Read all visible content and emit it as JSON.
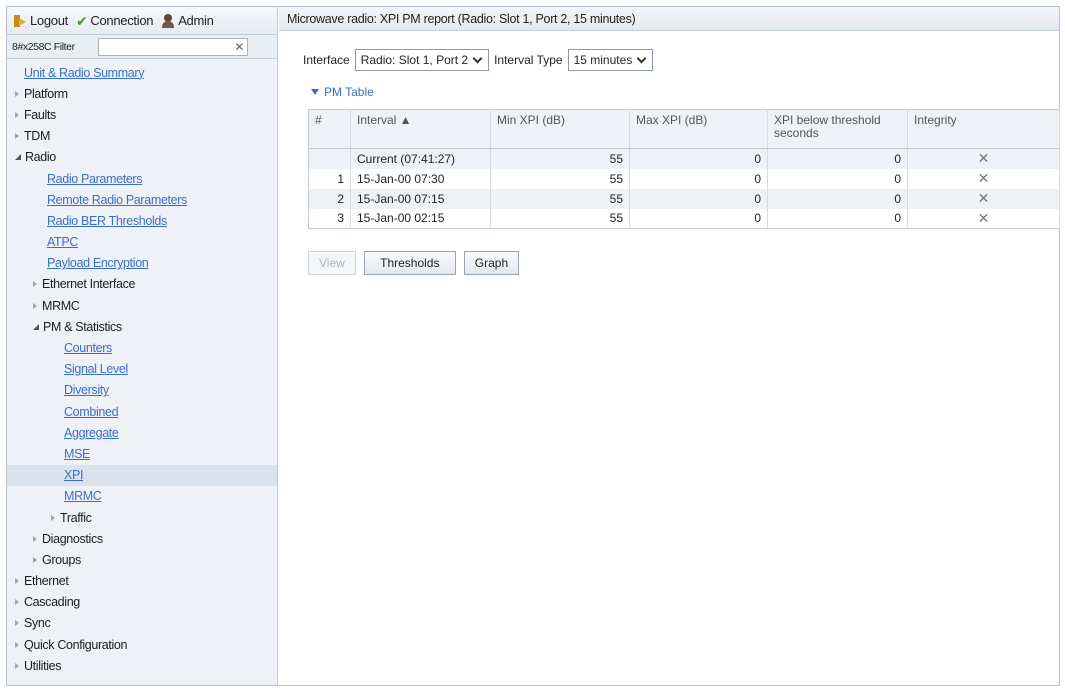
{
  "topbar": {
    "logout": "Logout",
    "connection": "Connection",
    "admin": "Admin"
  },
  "filter": {
    "label": "8#x258C Filter",
    "value": ""
  },
  "nav": [
    {
      "label": "Unit & Radio Summary",
      "level": 0,
      "link": true
    },
    {
      "label": "Platform",
      "level": 0,
      "expand": "collapsed"
    },
    {
      "label": "Faults",
      "level": 0,
      "expand": "collapsed"
    },
    {
      "label": "TDM",
      "level": 0,
      "expand": "collapsed"
    },
    {
      "label": "Radio",
      "level": 0,
      "expand": "expanded"
    },
    {
      "label": "Radio Parameters",
      "level": 1,
      "link": true
    },
    {
      "label": "Remote Radio Parameters",
      "level": 1,
      "link": true
    },
    {
      "label": "Radio BER Thresholds",
      "level": 1,
      "link": true
    },
    {
      "label": "ATPC",
      "level": 1,
      "link": true
    },
    {
      "label": "Payload Encryption",
      "level": 1,
      "link": true
    },
    {
      "label": "Ethernet Interface",
      "level": 1,
      "expand": "collapsed"
    },
    {
      "label": "MRMC",
      "level": 1,
      "expand": "collapsed"
    },
    {
      "label": "PM & Statistics",
      "level": 1,
      "expand": "expanded"
    },
    {
      "label": "Counters",
      "level": 2,
      "link": true
    },
    {
      "label": "Signal Level",
      "level": 2,
      "link": true
    },
    {
      "label": "Diversity",
      "level": 2,
      "link": true
    },
    {
      "label": "Combined",
      "level": 2,
      "link": true
    },
    {
      "label": "Aggregate",
      "level": 2,
      "link": true
    },
    {
      "label": "MSE",
      "level": 2,
      "link": true
    },
    {
      "label": "XPI",
      "level": 2,
      "link": true,
      "selected": true
    },
    {
      "label": "MRMC",
      "level": 2,
      "link": true
    },
    {
      "label": "Traffic",
      "level": 2,
      "expand": "collapsed"
    },
    {
      "label": "Diagnostics",
      "level": 1,
      "expand": "collapsed"
    },
    {
      "label": "Groups",
      "level": 1,
      "expand": "collapsed"
    },
    {
      "label": "Ethernet",
      "level": 0,
      "expand": "collapsed"
    },
    {
      "label": "Cascading",
      "level": 0,
      "expand": "collapsed"
    },
    {
      "label": "Sync",
      "level": 0,
      "expand": "collapsed"
    },
    {
      "label": "Quick Configuration",
      "level": 0,
      "expand": "collapsed"
    },
    {
      "label": "Utilities",
      "level": 0,
      "expand": "collapsed"
    }
  ],
  "main": {
    "title": "Microwave radio: XPI PM report (Radio: Slot 1, Port 2, 15 minutes)",
    "interface_label": "Interface",
    "interface_value": "Radio: Slot 1, Port 2",
    "interval_type_label": "Interval Type",
    "interval_type_value": "15 minutes",
    "section_title": "PM Table"
  },
  "table": {
    "headers": [
      "#",
      "Interval ▲",
      "Min XPI (dB)",
      "Max XPI (dB)",
      "XPI below threshold seconds",
      "Integrity"
    ],
    "rows": [
      {
        "num": "",
        "interval": "Current (07:41:27)",
        "min": "55",
        "max": "0",
        "below": "0",
        "integrity": "✕"
      },
      {
        "num": "1",
        "interval": "15-Jan-00 07:30",
        "min": "55",
        "max": "0",
        "below": "0",
        "integrity": "✕"
      },
      {
        "num": "2",
        "interval": "15-Jan-00 07:15",
        "min": "55",
        "max": "0",
        "below": "0",
        "integrity": "✕"
      },
      {
        "num": "3",
        "interval": "15-Jan-00 02:15",
        "min": "55",
        "max": "0",
        "below": "0",
        "integrity": "✕"
      }
    ]
  },
  "buttons": {
    "view": "View",
    "thresholds": "Thresholds",
    "graph": "Graph"
  },
  "colors": {
    "link": "#3b6fc4",
    "sidebar_bg": "#eef2f7",
    "row_alt": "#eef1f5",
    "selected": "#d9e2ee"
  }
}
